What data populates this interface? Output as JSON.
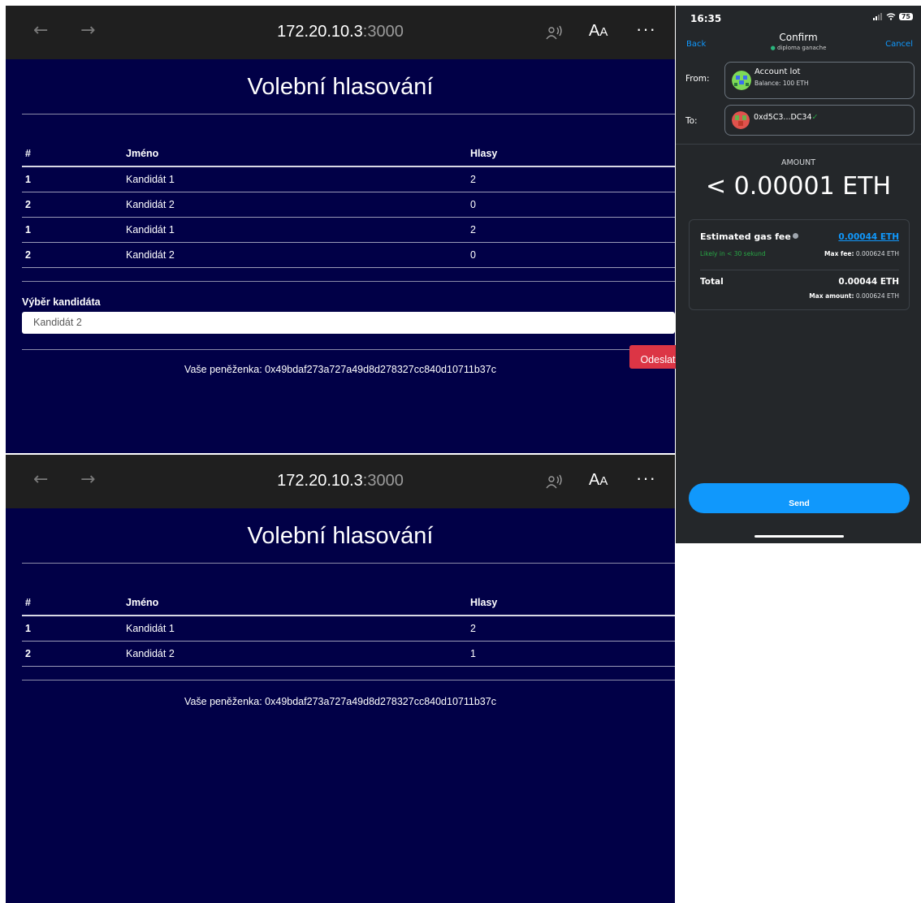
{
  "browser_top": {
    "nav": {
      "back": "←",
      "forward": "→"
    },
    "url": {
      "host": "172.20.10.3",
      "port": ":3000"
    },
    "aa_main": "A",
    "aa_small": "A",
    "more": "···",
    "page_title": "Volební hlasování",
    "table": {
      "headers": [
        "#",
        "Jméno",
        "Hlasy"
      ],
      "rows": [
        [
          "1",
          "Kandidát 1",
          "2"
        ],
        [
          "2",
          "Kandidát 2",
          "0"
        ],
        [
          "1",
          "Kandidát 1",
          "2"
        ],
        [
          "2",
          "Kandidát 2",
          "0"
        ]
      ]
    },
    "select_label": "Výběr kandidáta",
    "select_value": "Kandidát 2",
    "submit_label": "Odeslat",
    "wallet_text": "Vaše peněženka: 0x49bdaf273a727a49d8d278327cc840d10711b37c"
  },
  "browser_bottom": {
    "nav": {
      "back": "←",
      "forward": "→"
    },
    "url": {
      "host": "172.20.10.3",
      "port": ":3000"
    },
    "aa_main": "A",
    "aa_small": "A",
    "more": "···",
    "page_title": "Volební hlasování",
    "table": {
      "headers": [
        "#",
        "Jméno",
        "Hlasy"
      ],
      "rows": [
        [
          "1",
          "Kandidát 1",
          "2"
        ],
        [
          "2",
          "Kandidát 2",
          "1"
        ]
      ]
    },
    "wallet_text": "Vaše peněženka: 0x49bdaf273a727a49d8d278327cc840d10711b37c"
  },
  "phone": {
    "time": "16:35",
    "battery": "75",
    "back": "Back",
    "cancel": "Cancel",
    "title": "Confirm",
    "network": "diploma ganache",
    "from_label": "From:",
    "account_name": "Account lot",
    "account_balance": "Balance: 100 ETH",
    "to_label": "To:",
    "to_address": "0xd5C3...DC34",
    "amount_label": "AMOUNT",
    "amount": "< 0.00001 ETH",
    "fee_title": "Estimated gas fee",
    "fee_value": "0.00044 ETH",
    "likely": "Likely in < 30 sekund",
    "max_fee_label": "Max fee:",
    "max_fee_value": "0.000624 ETH",
    "total_label": "Total",
    "total_value": "0.00044 ETH",
    "max_amount_label": "Max amount:",
    "max_amount_value": "0.000624 ETH",
    "send": "Send",
    "colors": {
      "accent": "#1098fc",
      "bg": "#24272a",
      "success": "#28a745"
    }
  },
  "colors": {
    "page_bg": "#010047",
    "chrome_bg": "#1f1f1f",
    "danger": "#dc3545"
  }
}
